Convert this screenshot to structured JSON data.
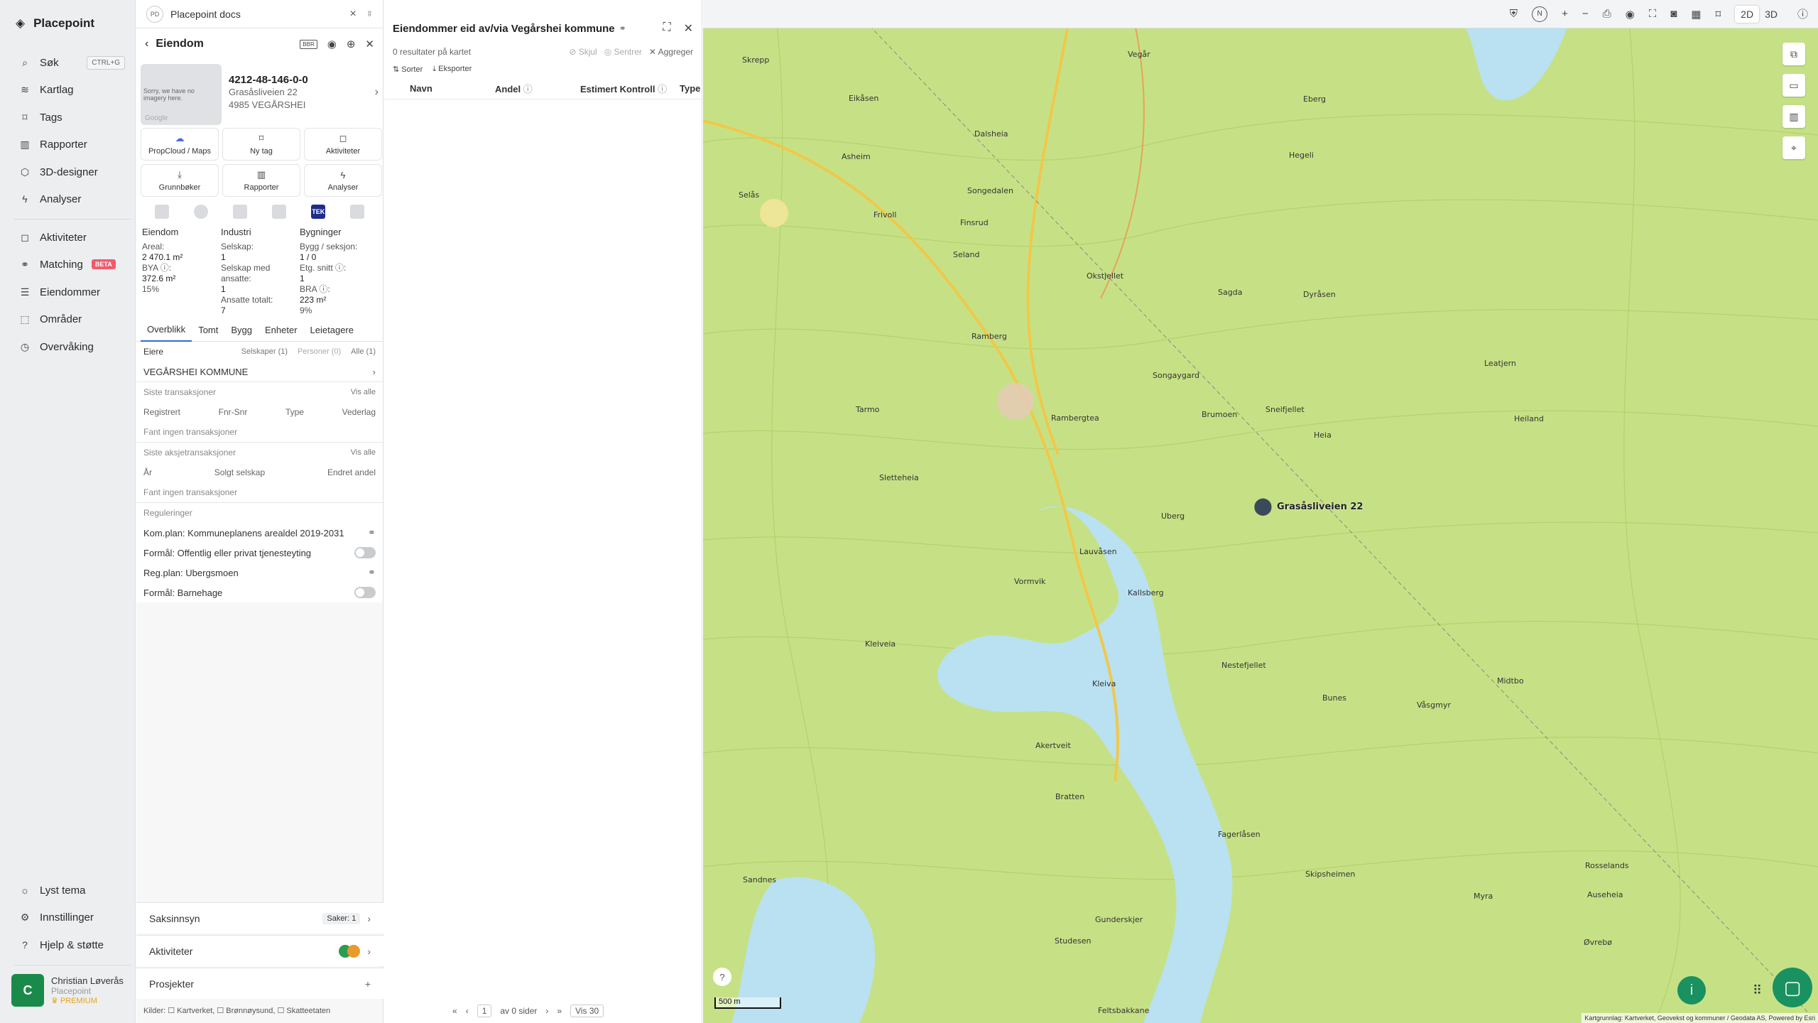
{
  "app": {
    "name": "Placepoint"
  },
  "sidebar": {
    "items": [
      {
        "label": "Søk",
        "icon": "search-icon",
        "shortcut": "CTRL+G"
      },
      {
        "label": "Kartlag",
        "icon": "layers-icon"
      },
      {
        "label": "Tags",
        "icon": "bookmark-icon"
      },
      {
        "label": "Rapporter",
        "icon": "chart-icon"
      },
      {
        "label": "3D-designer",
        "icon": "cube-icon"
      },
      {
        "label": "Analyser",
        "icon": "bolt-icon"
      },
      {
        "label": "Aktiviteter",
        "icon": "chat-icon"
      },
      {
        "label": "Matching",
        "icon": "link-icon",
        "badge": "BETA"
      },
      {
        "label": "Eiendommer",
        "icon": "list-icon"
      },
      {
        "label": "Områder",
        "icon": "area-icon"
      },
      {
        "label": "Overvåking",
        "icon": "clock-icon"
      }
    ],
    "bottom": [
      {
        "label": "Lyst tema",
        "icon": "sun-icon"
      },
      {
        "label": "Innstillinger",
        "icon": "gear-icon"
      },
      {
        "label": "Hjelp & støtte",
        "icon": "help-icon"
      }
    ],
    "user": {
      "initial": "C",
      "name": "Christian Løverås",
      "org": "Placepoint",
      "badge": "PREMIUM"
    }
  },
  "docs": {
    "avatar": "PD",
    "label": "Placepoint docs"
  },
  "property_panel": {
    "title": "Eiendom",
    "icon_label": "BBR",
    "id": "4212-48-146-0-0",
    "address1": "Grasåsliveien 22",
    "address2": "4985 VEGÅRSHEI",
    "thumb_text": "Sorry, we have no imagery here.",
    "thumb_brand": "Google",
    "buttons": [
      {
        "label": "PropCloud / Maps",
        "icon": "cloud-icon"
      },
      {
        "label": "Ny tag",
        "icon": "bookmark-icon"
      },
      {
        "label": "Aktiviteter",
        "icon": "chat-icon"
      },
      {
        "label": "Grunnbøker",
        "icon": "download-icon"
      },
      {
        "label": "Rapporter",
        "icon": "chart-icon"
      },
      {
        "label": "Analyser",
        "icon": "bolt-icon"
      }
    ],
    "tek": "TEK",
    "stats": {
      "eiendom": {
        "heading": "Eiendom",
        "areal_label": "Areal:",
        "areal": "2 470.1 m²",
        "bya_label": "BYA ⓘ:",
        "bya": "372.6 m²",
        "bya_pct": "15%"
      },
      "industri": {
        "heading": "Industri",
        "selskap_label": "Selskap:",
        "selskap": "1",
        "ansatte_label": "Selskap med ansatte:",
        "ansatte": "1",
        "total_label": "Ansatte totalt:",
        "total": "7"
      },
      "bygninger": {
        "heading": "Bygninger",
        "seksjon_label": "Bygg / seksjon:",
        "seksjon": "1 / 0",
        "etg_label": "Etg. snitt ⓘ:",
        "etg": "1",
        "bra_label": "BRA ⓘ:",
        "bra": "223 m²",
        "bra_pct": "9%"
      }
    },
    "tabs": [
      "Overblikk",
      "Tomt",
      "Bygg",
      "Enheter",
      "Leietagere"
    ],
    "owners": {
      "label": "Eiere",
      "f1": "Selskaper (1)",
      "f2": "Personer (0)",
      "f3": "Alle (1)",
      "owner": "VEGÅRSHEI KOMMUNE"
    },
    "transactions": {
      "title": "Siste transaksjoner",
      "link": "Vis alle",
      "cols": [
        "Registrert",
        "Fnr-Snr",
        "Type",
        "Vederlag"
      ],
      "empty": "Fant ingen transaksjoner"
    },
    "stock": {
      "title": "Siste aksjetransaksjoner",
      "link": "Vis alle",
      "cols": [
        "År",
        "Solgt selskap",
        "Endret andel"
      ],
      "empty": "Fant ingen transaksjoner"
    },
    "regulations": {
      "title": "Reguleringer",
      "items": [
        "Kom.plan: Kommuneplanens arealdel 2019-2031",
        "Formål: Offentlig eller privat tjenesteyting",
        "Reg.plan: Ubergsmoen",
        "Formål: Barnehage"
      ]
    },
    "bottom": {
      "saksinnsyn": "Saksinnsyn",
      "saker": "Saker: 1",
      "aktiviteter": "Aktiviteter",
      "prosjekter": "Prosjekter",
      "kilder": "Kilder: ☐ Kartverket, ☐ Brønnøysund, ☐ Skatteetaten"
    }
  },
  "owned_panel": {
    "title": "Eiendommer eid av/via Vegårshei kommune",
    "results": "0 resultater på kartet",
    "acts": [
      "Skjul",
      "Sentrer",
      "Aggreger"
    ],
    "tools": [
      "Sorter",
      "Eksporter"
    ],
    "columns": [
      "Navn",
      "Andel",
      "Estimert Kontroll",
      "Type"
    ],
    "pager": {
      "page": "1",
      "of": "av 0 sider",
      "per": "Vis 30"
    }
  },
  "map": {
    "toolbar": {
      "mode2d": "2D",
      "mode3d": "3D"
    },
    "marker_label": "Grasåsliveien 22",
    "scale": "500 m",
    "attribution": "Kartgrunnlag: Kartverket, Geovekst og kommuner / Geodata AS, Powered by Esri",
    "labels": [
      "Skrepp",
      "Eikåsen",
      "Dalsheia",
      "Vegår",
      "Asheim",
      "Frivoll",
      "Songedalen",
      "Finsrud",
      "Selås",
      "Seland",
      "Okstjellet",
      "Sagda",
      "Dyråsen",
      "Hegeli",
      "Ramberg",
      "Songaygard",
      "Rambergtea",
      "Brumoen",
      "Sneifjellet",
      "Tarmo",
      "Sletteheia",
      "Uberg",
      "Lauvåsen",
      "Vormvik",
      "Kallsberg",
      "Kleiveia",
      "Kleiva",
      "Nestefjellet",
      "Akertveit",
      "Bratten",
      "Fagerlåsen",
      "Bunes",
      "Våsgmyr",
      "Midtbo",
      "Skipsheimen",
      "Gunderskjer",
      "Sandnes",
      "Studesen",
      "Feltsbakkane",
      "Eberg",
      "Heia",
      "Øvrebø",
      "Myra",
      "Auseheia",
      "Rosselands",
      "Heiland",
      "Leatjern"
    ]
  }
}
